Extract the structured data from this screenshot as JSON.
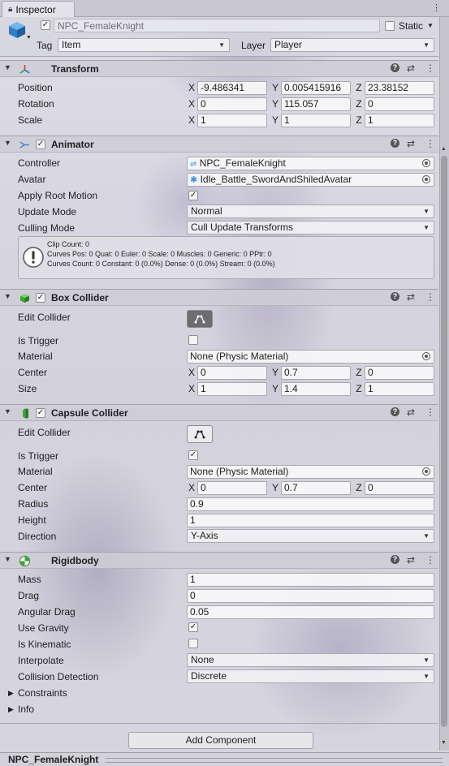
{
  "window": {
    "tab_title": "Inspector",
    "tab_menu": "⋮"
  },
  "gameobject": {
    "name": "NPC_FemaleKnight",
    "static_label": "Static",
    "tag_label": "Tag",
    "tag_value": "Item",
    "layer_label": "Layer",
    "layer_value": "Player"
  },
  "transform": {
    "title": "Transform",
    "rows": [
      {
        "label": "Position",
        "x": "-9.486341",
        "y": "0.005415916",
        "z": "23.38152"
      },
      {
        "label": "Rotation",
        "x": "0",
        "y": "115.057",
        "z": "0"
      },
      {
        "label": "Scale",
        "x": "1",
        "y": "1",
        "z": "1"
      }
    ]
  },
  "axis": {
    "x": "X",
    "y": "Y",
    "z": "Z"
  },
  "animator": {
    "title": "Animator",
    "controller_label": "Controller",
    "controller_value": "NPC_FemaleKnight",
    "avatar_label": "Avatar",
    "avatar_value": "Idle_Battle_SwordAndShiledAvatar",
    "apply_root_motion_label": "Apply Root Motion",
    "update_mode_label": "Update Mode",
    "update_mode_value": "Normal",
    "culling_mode_label": "Culling Mode",
    "culling_mode_value": "Cull Update Transforms",
    "info_lines": [
      "Clip Count: 0",
      "Curves Pos: 0 Quat: 0 Euler: 0 Scale: 0 Muscles: 0 Generic: 0 PPtr: 0",
      "Curves Count: 0 Constant: 0 (0.0%) Dense: 0 (0.0%) Stream: 0 (0.0%)"
    ]
  },
  "box_collider": {
    "title": "Box Collider",
    "edit_collider_label": "Edit Collider",
    "is_trigger_label": "Is Trigger",
    "material_label": "Material",
    "material_value": "None (Physic Material)",
    "center_label": "Center",
    "center": {
      "x": "0",
      "y": "0.7",
      "z": "0"
    },
    "size_label": "Size",
    "size": {
      "x": "1",
      "y": "1.4",
      "z": "1"
    }
  },
  "capsule_collider": {
    "title": "Capsule Collider",
    "edit_collider_label": "Edit Collider",
    "is_trigger_label": "Is Trigger",
    "material_label": "Material",
    "material_value": "None (Physic Material)",
    "center_label": "Center",
    "center": {
      "x": "0",
      "y": "0.7",
      "z": "0"
    },
    "radius_label": "Radius",
    "radius_value": "0.9",
    "height_label": "Height",
    "height_value": "1",
    "direction_label": "Direction",
    "direction_value": "Y-Axis"
  },
  "rigidbody": {
    "title": "Rigidbody",
    "mass_label": "Mass",
    "mass_value": "1",
    "drag_label": "Drag",
    "drag_value": "0",
    "angular_drag_label": "Angular Drag",
    "angular_drag_value": "0.05",
    "use_gravity_label": "Use Gravity",
    "is_kinematic_label": "Is Kinematic",
    "interpolate_label": "Interpolate",
    "interpolate_value": "None",
    "collision_detection_label": "Collision Detection",
    "collision_detection_value": "Discrete",
    "constraints_label": "Constraints",
    "info_label": "Info"
  },
  "add_component_label": "Add Component",
  "footer_title": "NPC_FemaleKnight",
  "colors": {
    "accent_blue": "#3d8fd6",
    "selected_button": "#6d6c71"
  }
}
